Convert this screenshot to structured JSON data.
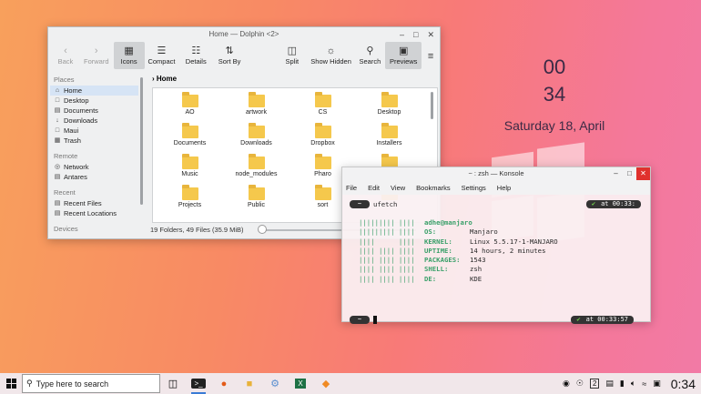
{
  "desktop": {
    "clock_hours": "00",
    "clock_minutes": "34",
    "date": "Saturday 18, April"
  },
  "dolphin": {
    "title": "Home — Dolphin <2>",
    "toolbar": [
      {
        "label": "Back",
        "icon": "back-arrow-icon",
        "disabled": true
      },
      {
        "label": "Forward",
        "icon": "forward-arrow-icon",
        "disabled": true
      },
      {
        "label": "Icons",
        "icon": "icons-view-icon",
        "active": true
      },
      {
        "label": "Compact",
        "icon": "compact-view-icon"
      },
      {
        "label": "Details",
        "icon": "details-view-icon"
      },
      {
        "label": "Sort By",
        "icon": "sort-icon"
      },
      {
        "label": "Split",
        "icon": "split-icon"
      },
      {
        "label": "Show Hidden",
        "icon": "show-hidden-icon"
      },
      {
        "label": "Search",
        "icon": "search-icon"
      },
      {
        "label": "Previews",
        "icon": "previews-icon",
        "active": true
      }
    ],
    "breadcrumb": "Home",
    "sidebar": {
      "places_heading": "Places",
      "places": [
        "Home",
        "Desktop",
        "Documents",
        "Downloads",
        "Maui",
        "Trash"
      ],
      "remote_heading": "Remote",
      "remote": [
        "Network",
        "Antares"
      ],
      "recent_heading": "Recent",
      "recent": [
        "Recent Files",
        "Recent Locations"
      ],
      "devices_heading": "Devices"
    },
    "files": [
      "AO",
      "artwork",
      "CS",
      "Desktop",
      "Documents",
      "Downloads",
      "Dropbox",
      "Installers",
      "Music",
      "node_modules",
      "Pharo",
      "",
      "Projects",
      "Public",
      "sort",
      ""
    ],
    "status": "19 Folders, 49 Files (35.9 MiB)"
  },
  "konsole": {
    "title": "~ : zsh — Konsole",
    "menu": [
      "File",
      "Edit",
      "View",
      "Bookmarks",
      "Settings",
      "Help"
    ],
    "command": "ufetch",
    "right_prompt_1": "at 00:33:",
    "right_prompt_2": "at 00:33:57",
    "prompt_tilde": "~",
    "userhost": "adhe@manjaro",
    "info": [
      {
        "key": "OS:",
        "value": "Manjaro"
      },
      {
        "key": "KERNEL:",
        "value": "Linux 5.5.17-1-MANJARO"
      },
      {
        "key": "UPTIME:",
        "value": "14 hours, 2 minutes"
      },
      {
        "key": "PACKAGES:",
        "value": "1543"
      },
      {
        "key": "SHELL:",
        "value": "zsh"
      },
      {
        "key": "DE:",
        "value": "KDE"
      }
    ],
    "logo_lines": [
      "||||||||| ||||",
      "||||||||| ||||",
      "||||      ||||",
      "|||| |||| ||||",
      "|||| |||| ||||",
      "|||| |||| ||||",
      "|||| |||| ||||"
    ]
  },
  "taskbar": {
    "search_placeholder": "Type here to search",
    "clock": "0:34",
    "tray_badge": "2"
  }
}
